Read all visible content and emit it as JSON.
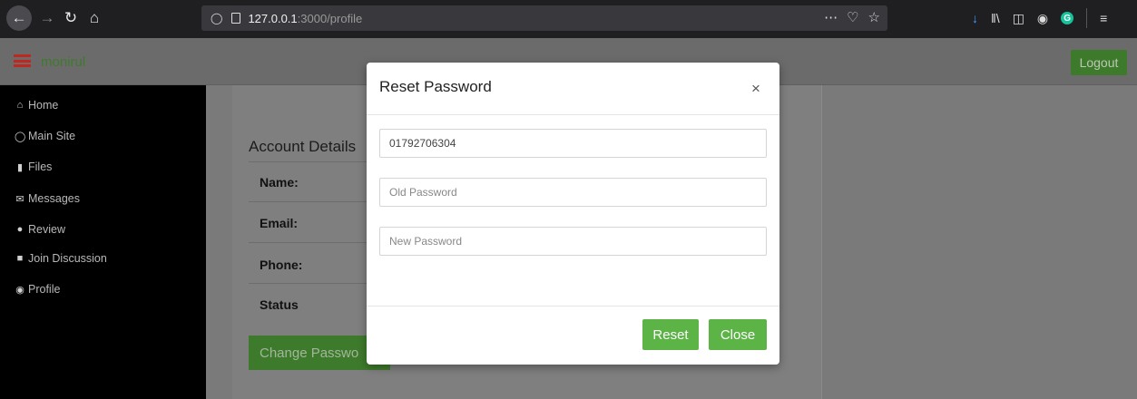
{
  "browser": {
    "url_host": "127.0.0.1",
    "url_path": ":3000/profile"
  },
  "header": {
    "user_name": "monirul",
    "logout_label": "Logout"
  },
  "sidebar": {
    "items": [
      {
        "label": "Home",
        "icon": "home-icon"
      },
      {
        "label": "Main Site",
        "icon": "globe-icon"
      },
      {
        "label": "Files",
        "icon": "folder-icon"
      },
      {
        "label": "Messages",
        "icon": "envelope-icon"
      },
      {
        "label": "Review",
        "icon": "comments-icon"
      },
      {
        "label": "Join Discussion",
        "icon": "facebook-icon"
      },
      {
        "label": "Profile",
        "icon": "user-circle-icon"
      }
    ]
  },
  "account": {
    "title": "Account Details",
    "labels": [
      "Name:",
      "Email:",
      "Phone:",
      "Status"
    ],
    "change_password_label": "Change Passwo"
  },
  "modal": {
    "title": "Reset Password",
    "close_icon": "×",
    "phone_value": "01792706304",
    "old_password_placeholder": "Old Password",
    "new_password_placeholder": "New Password",
    "reset_label": "Reset",
    "close_label": "Close"
  },
  "colors": {
    "accent_green": "#5cb447",
    "dark_green": "#3e7a2c",
    "hamburger_red": "#c0271f"
  }
}
